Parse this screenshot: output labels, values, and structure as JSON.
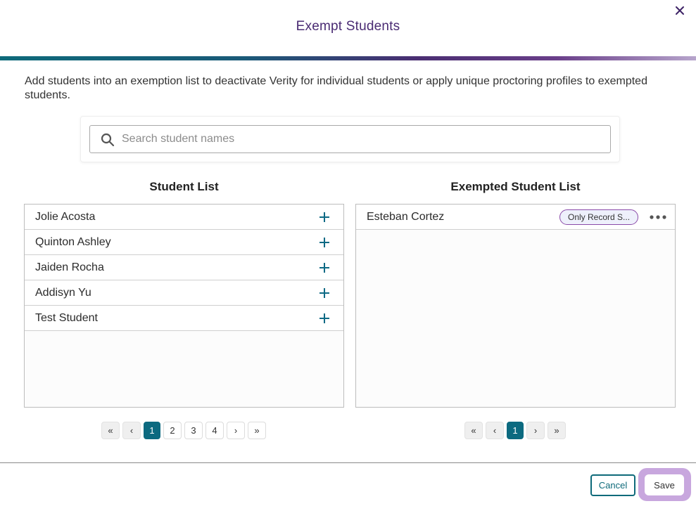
{
  "dialog": {
    "title": "Exempt Students",
    "description": "Add students into an exemption list to deactivate Verity for individual students or apply unique proctoring profiles to exempted students."
  },
  "search": {
    "placeholder": "Search student names",
    "value": ""
  },
  "student_list": {
    "heading": "Student List",
    "items": [
      {
        "name": "Jolie Acosta"
      },
      {
        "name": "Quinton Ashley"
      },
      {
        "name": "Jaiden Rocha"
      },
      {
        "name": "Addisyn Yu"
      },
      {
        "name": "Test Student"
      }
    ],
    "pagination": {
      "first": "«",
      "prev": "‹",
      "pages": [
        "1",
        "2",
        "3",
        "4"
      ],
      "current_page": "1",
      "next": "›",
      "last": "»"
    }
  },
  "exempted_list": {
    "heading": "Exempted Student List",
    "items": [
      {
        "name": "Esteban Cortez",
        "badge": "Only Record S..."
      }
    ],
    "pagination": {
      "first": "«",
      "prev": "‹",
      "pages": [
        "1"
      ],
      "current_page": "1",
      "next": "›",
      "last": "»"
    }
  },
  "footer": {
    "cancel_label": "Cancel",
    "save_label": "Save"
  },
  "icons": {
    "close": "close-icon",
    "search": "search-icon",
    "add": "plus-icon",
    "more": "more-horizontal-icon"
  },
  "colors": {
    "title": "#4a2b73",
    "accent_teal": "#0c6a80",
    "badge_border": "#8a4aa8",
    "save_focus_ring": "#c8a7de"
  }
}
